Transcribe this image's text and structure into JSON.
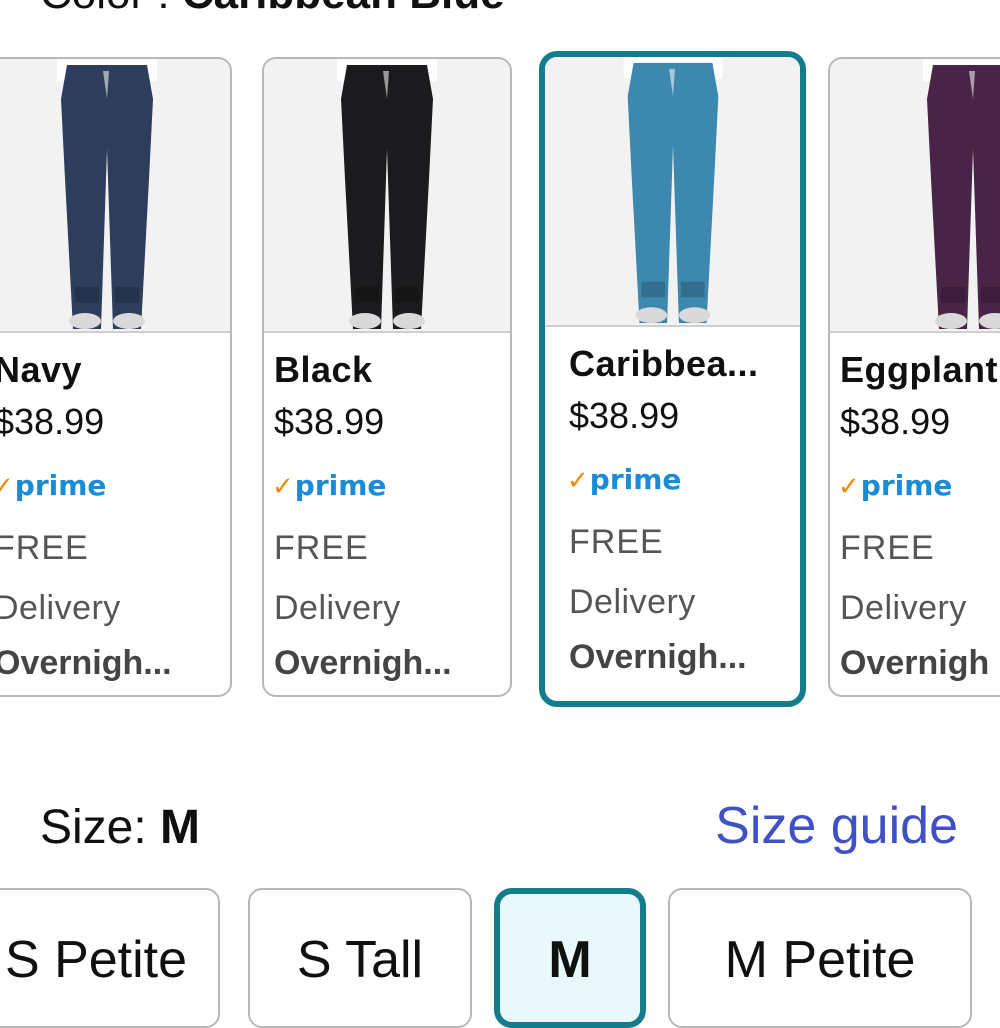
{
  "color": {
    "label": "Color : ",
    "selected": "Caribbean Blue"
  },
  "swatches": [
    {
      "name": "Navy",
      "price": "$38.99",
      "prime": "prime",
      "free": "FREE",
      "delivery": "Delivery",
      "speed": "Overnigh...",
      "pants_color": "#2e3d5c"
    },
    {
      "name": "Black",
      "price": "$38.99",
      "prime": "prime",
      "free": "FREE",
      "delivery": "Delivery",
      "speed": "Overnigh...",
      "pants_color": "#1b1b1d"
    },
    {
      "name": "Caribbea...",
      "price": "$38.99",
      "prime": "prime",
      "free": "FREE",
      "delivery": "Delivery",
      "speed": "Overnigh...",
      "pants_color": "#3d88ae"
    },
    {
      "name": "Eggplant",
      "price": "$38.99",
      "prime": "prime",
      "free": "FREE",
      "delivery": "Delivery",
      "speed": "Overnigh",
      "pants_color": "#4a2446"
    }
  ],
  "size": {
    "label": "Size: ",
    "selected": "M",
    "guide_label": "Size guide",
    "options": [
      "S Petite",
      "S Tall",
      "M",
      "M Petite"
    ]
  },
  "colors": {
    "accent": "#147c8a",
    "link": "#3f51c4",
    "prime_blue": "#1a8bd6",
    "prime_check": "#f08804"
  }
}
